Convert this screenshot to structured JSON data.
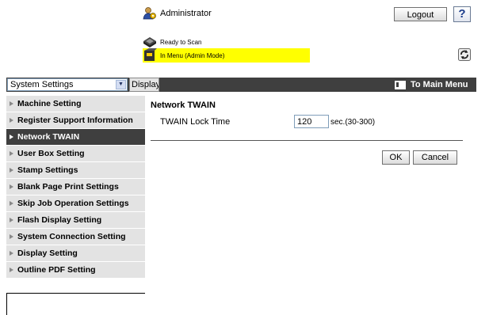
{
  "header": {
    "user_label": "Administrator",
    "logout_label": "Logout",
    "help_label": "?",
    "status_ready": "Ready to Scan",
    "status_mode": "In Menu (Admin Mode)"
  },
  "toolbar": {
    "category_select": "System Settings",
    "display_button": "Display",
    "main_menu_label": "To Main Menu"
  },
  "sidebar": {
    "items": [
      {
        "label": "Machine Setting"
      },
      {
        "label": "Register Support Information"
      },
      {
        "label": "Network TWAIN"
      },
      {
        "label": "User Box Setting"
      },
      {
        "label": "Stamp Settings"
      },
      {
        "label": "Blank Page Print Settings"
      },
      {
        "label": "Skip Job Operation Settings"
      },
      {
        "label": "Flash Display Setting"
      },
      {
        "label": "System Connection Setting"
      },
      {
        "label": "Display Setting"
      },
      {
        "label": "Outline PDF Setting"
      }
    ],
    "active_index": 2
  },
  "content": {
    "title": "Network TWAIN",
    "lock_time_label": "TWAIN Lock Time",
    "lock_time_value": "120",
    "lock_time_unit": "sec.(30-300)",
    "ok_label": "OK",
    "cancel_label": "Cancel"
  },
  "colors": {
    "bar": "#3f3f3f",
    "status_highlight": "#ffff00",
    "sidebar_bg": "#e3e3e3"
  }
}
